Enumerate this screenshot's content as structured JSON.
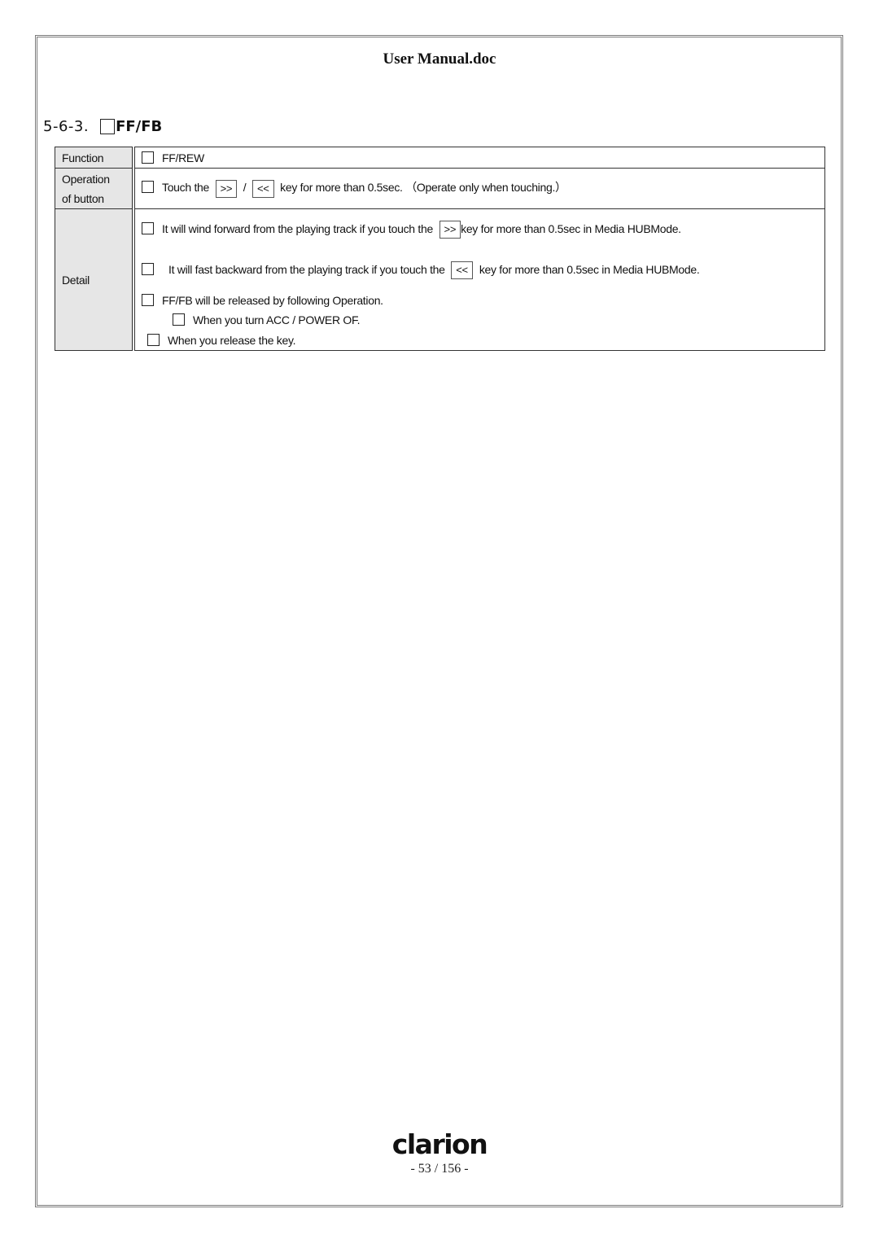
{
  "header": {
    "title": "User Manual.doc"
  },
  "section": {
    "number": "5-6-3.",
    "title": "FF/FB"
  },
  "table": {
    "function": {
      "label": "Function",
      "text": "FF/REW"
    },
    "operation": {
      "label_line1": "Operation",
      "label_line2": "of button",
      "prefix": "Touch the",
      "key_forward": ">>",
      "separator": "/",
      "key_backward": "<<",
      "suffix": "key for more than 0.5sec. （Operate only when touching.）"
    },
    "detail": {
      "label": "Detail",
      "items": [
        {
          "prefix": "It will wind forward from the playing track if you touch the",
          "key": ">>",
          "suffix": "key for more than 0.5sec in Media HUBMode."
        },
        {
          "prefix": "It will fast backward from the playing track if you touch the",
          "key": "<<",
          "suffix": "key for more than 0.5sec in Media HUBMode."
        }
      ],
      "release_intro": "FF/FB will be released by following Operation.",
      "release_items": [
        "When you turn ACC / POWER  OF.",
        "When you release the key."
      ]
    }
  },
  "footer": {
    "brand": "clarion",
    "page": "- 53 / 156 -"
  }
}
